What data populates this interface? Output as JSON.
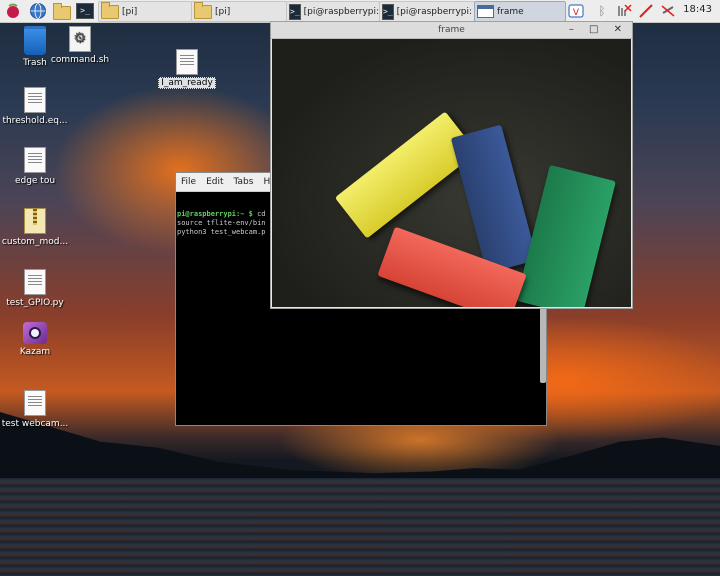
{
  "taskbar": {
    "buttons": [
      {
        "label": "[pi]"
      },
      {
        "label": "[pi]"
      },
      {
        "label": "[pi@raspberrypi: ..."
      },
      {
        "label": "[pi@raspberrypi: ~"
      },
      {
        "label": "frame"
      }
    ],
    "clock": "18:43"
  },
  "desktop": {
    "icons": [
      {
        "label": "Trash"
      },
      {
        "label": "command.sh"
      },
      {
        "label": "I_am_ready"
      },
      {
        "label": "threshold.eq..."
      },
      {
        "label": "edge tou"
      },
      {
        "label": "custom_mod..."
      },
      {
        "label": "test_GPIO.py"
      },
      {
        "label": "Kazam"
      },
      {
        "label": "test webcam..."
      }
    ]
  },
  "terminal": {
    "menu": [
      "File",
      "Edit",
      "Tabs",
      "Hel"
    ],
    "prompt": "pi@raspberrypi:~ $",
    "cmd1": " cd",
    "line2": "source tflite-env/bin",
    "line3": "python3 test_webcam.p"
  },
  "frame_window": {
    "title": "frame",
    "controls": "– □ ✕"
  },
  "colors": {
    "yellow_block": "#e9e13a",
    "blue_block": "#2f4b86",
    "green_block": "#1f8a55",
    "red_block": "#e9574a"
  }
}
